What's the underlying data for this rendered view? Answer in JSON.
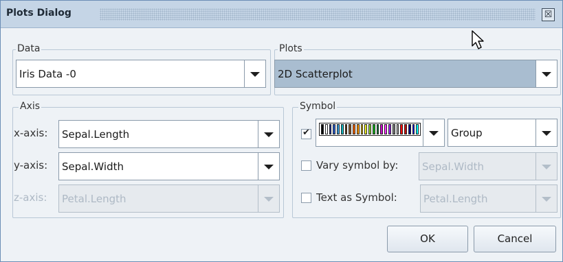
{
  "title": "Plots Dialog",
  "close_glyph": "☒",
  "data_group": {
    "legend": "Data",
    "selected": "Iris Data -0"
  },
  "plots_group": {
    "legend": "Plots",
    "selected": "2D Scatterplot"
  },
  "axis_group": {
    "legend": "Axis",
    "rows": [
      {
        "label": "x-axis:",
        "value": "Sepal.Length",
        "enabled": true
      },
      {
        "label": "y-axis:",
        "value": "Sepal.Width",
        "enabled": true
      },
      {
        "label": "z-axis:",
        "value": "Petal.Length",
        "enabled": false
      }
    ]
  },
  "symbol_group": {
    "legend": "Symbol",
    "color_checked": true,
    "palette": [
      "#000000",
      "#ffffff",
      "#1e2f9e",
      "#2c5fd0",
      "#3aa0e0",
      "#11b9c0",
      "#6a3b13",
      "#8b5a2b",
      "#ff6600",
      "#ff9900",
      "#ffd200",
      "#f3f32a",
      "#8fd22a",
      "#19b31e",
      "#0d8c3a",
      "#cc00cc",
      "#ff33ff",
      "#a020f0",
      "#7d7d7d",
      "#bebebe",
      "#ff0000",
      "#c81010",
      "#000080",
      "#0000ff",
      "#00ffff"
    ],
    "group_value": "Group",
    "vary_label": "Vary symbol by:",
    "vary_checked": false,
    "vary_value": "Sepal.Width",
    "text_label": "Text as Symbol:",
    "text_checked": false,
    "text_value": "Petal.Length"
  },
  "buttons": {
    "ok": "OK",
    "cancel": "Cancel"
  }
}
